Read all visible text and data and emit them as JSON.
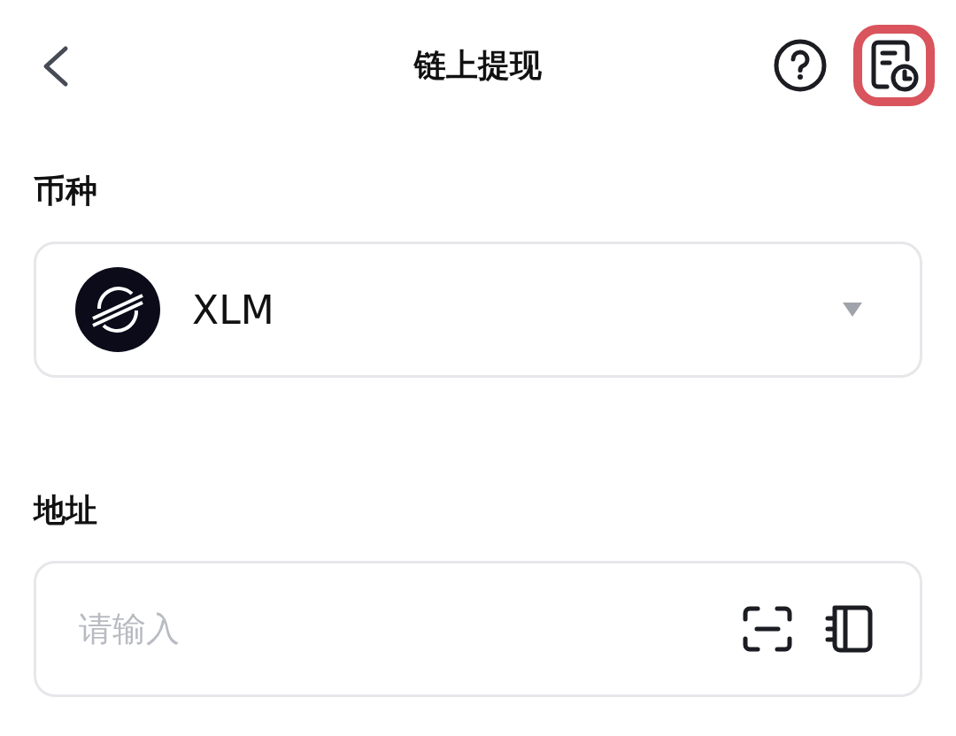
{
  "header": {
    "title": "链上提现"
  },
  "coin": {
    "label": "币种",
    "value": "XLM"
  },
  "address": {
    "label": "地址",
    "placeholder": "请输入"
  }
}
